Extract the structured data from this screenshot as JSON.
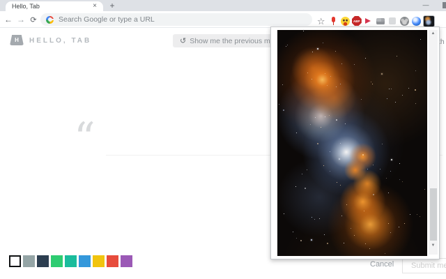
{
  "window": {
    "tab_title": "Hello, Tab",
    "close_tab_glyph": "×",
    "new_tab_glyph": "+",
    "minimize_glyph": "—"
  },
  "toolbar": {
    "back_glyph": "←",
    "forward_glyph": "→",
    "reload_glyph": "⟳",
    "omnibox_placeholder": "Search Google or type a URL",
    "extensions": [
      {
        "name": "bookmark-star"
      },
      {
        "name": "red-pin"
      },
      {
        "name": "smiley"
      },
      {
        "name": "adblock",
        "label": "ABP"
      },
      {
        "name": "share-arrow"
      },
      {
        "name": "window"
      },
      {
        "name": "dim"
      },
      {
        "name": "monkey"
      },
      {
        "name": "blue-globe"
      },
      {
        "name": "hello-tab-active"
      }
    ]
  },
  "page": {
    "logo_letter": "H",
    "title": "HELLO, TAB",
    "previous_button": {
      "icon": "↺",
      "label": "Show me the previous message aga"
    },
    "header_fragment": "th",
    "quote_mark": "“",
    "palette": {
      "selected_index": 0,
      "colors": [
        "#ffffff",
        "#95a5a6",
        "#2c3e50",
        "#2ecc71",
        "#1abc9c",
        "#3498db",
        "#f1c40f",
        "#e74c3c",
        "#9b59b6"
      ]
    },
    "cancel_label": "Cancel",
    "submit_label": "Submit mess"
  },
  "popup": {
    "image_name": "nebula-photo",
    "scroll_up_glyph": "▲",
    "scroll_down_glyph": "▼"
  }
}
